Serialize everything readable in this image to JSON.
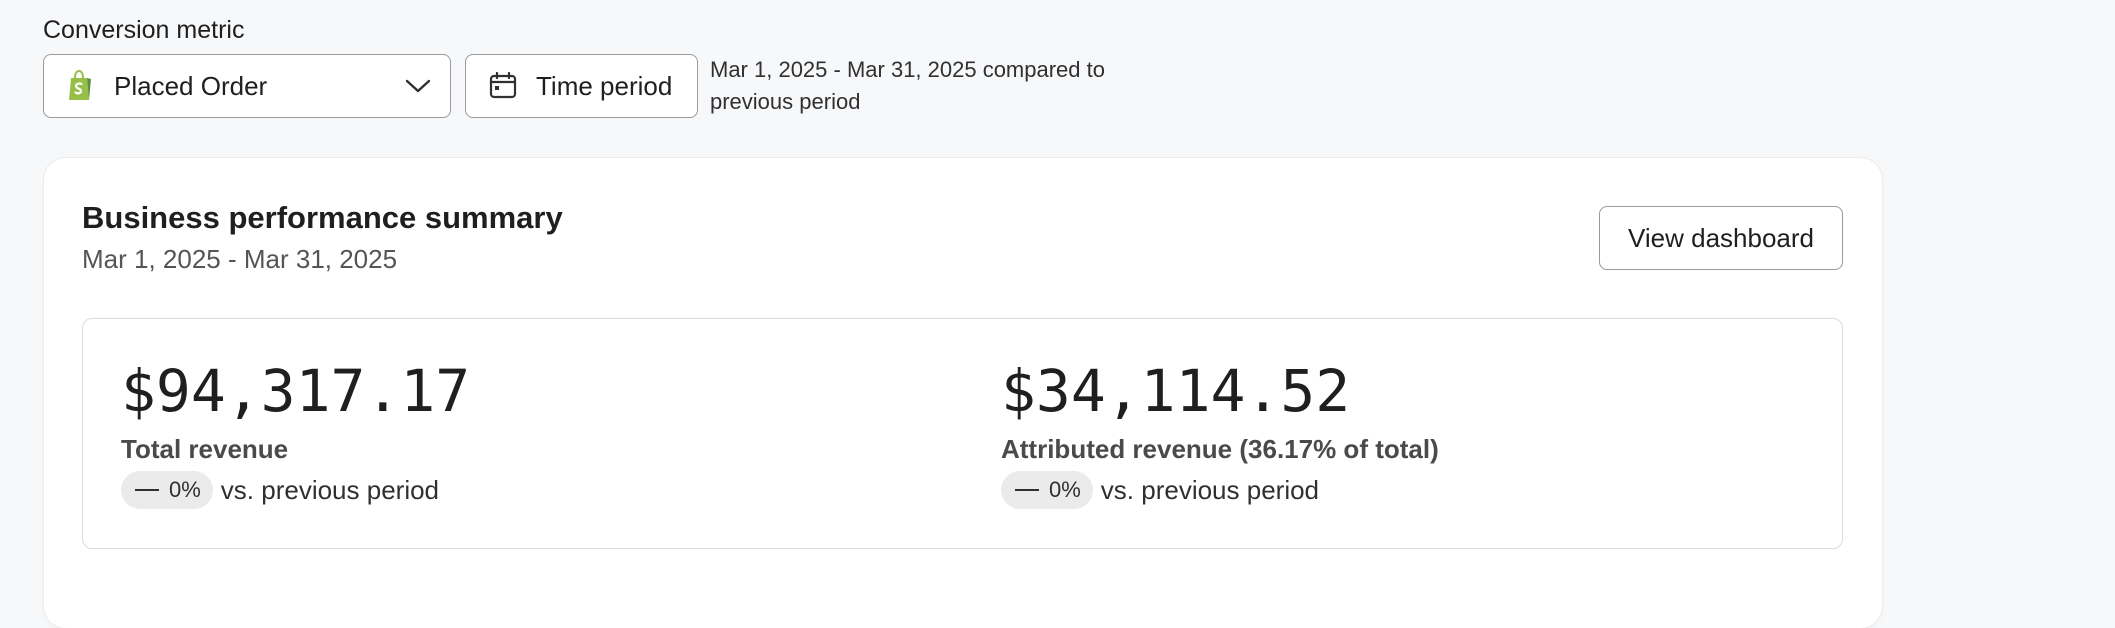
{
  "filters": {
    "conversion_label": "Conversion metric",
    "metric_select": {
      "value": "Placed Order",
      "icon": "shopify-bag-icon"
    },
    "time_button": {
      "label": "Time period",
      "icon": "calendar-icon"
    },
    "compare_text": "Mar 1, 2025 - Mar 31, 2025 compared to previous period"
  },
  "summary": {
    "title": "Business performance summary",
    "date_range": "Mar 1, 2025 - Mar 31, 2025",
    "view_dashboard_label": "View dashboard",
    "metrics": [
      {
        "value": "$94,317.17",
        "label": "Total revenue",
        "change": "0%",
        "comparison": "vs. previous period"
      },
      {
        "value": "$34,114.52",
        "label": "Attributed revenue (36.17% of total)",
        "change": "0%",
        "comparison": "vs. previous period"
      }
    ]
  },
  "colors": {
    "shopify_green": "#95bf47",
    "shopify_dark_green": "#5e8e3e",
    "page_background": "#f7f8fa",
    "pill_background": "#ebebeb"
  }
}
